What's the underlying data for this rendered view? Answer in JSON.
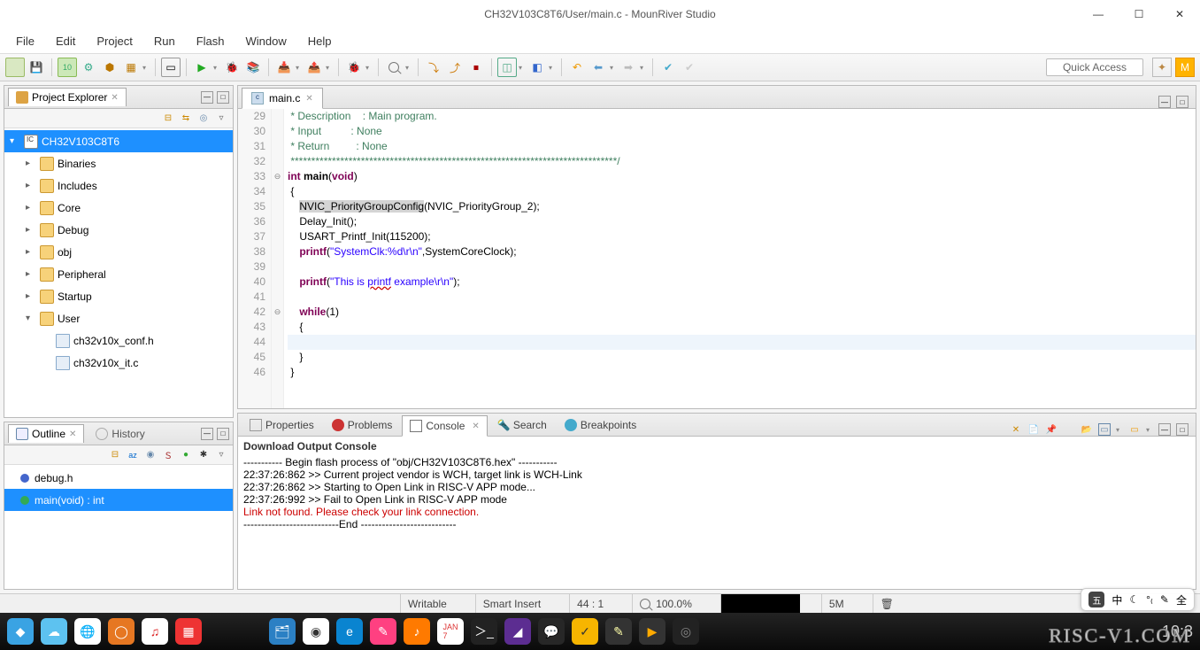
{
  "window": {
    "title": "CH32V103C8T6/User/main.c - MounRiver Studio"
  },
  "menu": [
    "File",
    "Edit",
    "Project",
    "Run",
    "Flash",
    "Window",
    "Help"
  ],
  "quick_access": "Quick Access",
  "explorer": {
    "title": "Project Explorer",
    "project": "CH32V103C8T6",
    "nodes": [
      {
        "label": "Binaries",
        "icon": "binaries",
        "indent": 1
      },
      {
        "label": "Includes",
        "icon": "includes",
        "indent": 1
      },
      {
        "label": "Core",
        "icon": "folder",
        "indent": 1
      },
      {
        "label": "Debug",
        "icon": "folder",
        "indent": 1
      },
      {
        "label": "obj",
        "icon": "folder",
        "indent": 1
      },
      {
        "label": "Peripheral",
        "icon": "folder",
        "indent": 1
      },
      {
        "label": "Startup",
        "icon": "folder",
        "indent": 1
      },
      {
        "label": "User",
        "icon": "folder",
        "indent": 1,
        "open": true
      },
      {
        "label": "ch32v10x_conf.h",
        "icon": "file",
        "indent": 2
      },
      {
        "label": "ch32v10x_it.c",
        "icon": "file",
        "indent": 2
      }
    ]
  },
  "editor": {
    "tab": "main.c",
    "lines": [
      {
        "n": 29,
        "cmt": " * Description    : Main program."
      },
      {
        "n": 30,
        "cmt": " * Input          : None"
      },
      {
        "n": 31,
        "cmt": " * Return         : None"
      },
      {
        "n": 32,
        "cmt": " *******************************************************************************/"
      },
      {
        "n": 33,
        "fold": "⊖",
        "raw": "<span class='kw'>int</span> <span class='fn' style='font-weight:bold'>main</span>(<span class='kw'>void</span>)"
      },
      {
        "n": 34,
        "raw": " {"
      },
      {
        "n": 35,
        "raw": "    <span class='fnh'>NVIC_PriorityGroupConfig</span>(NVIC_PriorityGroup_2);"
      },
      {
        "n": 36,
        "raw": "    Delay_Init();"
      },
      {
        "n": 37,
        "raw": "    USART_Printf_Init(115200);"
      },
      {
        "n": 38,
        "raw": "    <span class='kw'>printf</span>(<span class='str'>\"SystemClk:%d\\r\\n\"</span>,SystemCoreClock);"
      },
      {
        "n": 39,
        "raw": ""
      },
      {
        "n": 40,
        "raw": "    <span class='kw'>printf</span>(<span class='str'>\"This is <span class='underline'>printf</span> example\\r\\n\"</span>);"
      },
      {
        "n": 41,
        "raw": ""
      },
      {
        "n": 42,
        "fold": "⊖",
        "raw": "    <span class='kw'>while</span>(1)"
      },
      {
        "n": 43,
        "raw": "    {"
      },
      {
        "n": 44,
        "raw": "",
        "hl": true
      },
      {
        "n": 45,
        "raw": "    }"
      },
      {
        "n": 46,
        "raw": " }"
      }
    ]
  },
  "views": {
    "tabs": [
      "Properties",
      "Problems",
      "Console",
      "Search",
      "Breakpoints"
    ],
    "active": 2,
    "console_title": "Download Output Console",
    "console_lines": [
      {
        "t": "----------- Begin flash process of \"obj/CH32V103C8T6.hex\" -----------"
      },
      {
        "t": "22:37:26:862 >> Current project vendor is WCH, target link is WCH-Link"
      },
      {
        "t": ""
      },
      {
        "t": "22:37:26:862 >> Starting to Open Link in RISC-V APP mode..."
      },
      {
        "t": "22:37:26:992 >> Fail to Open Link in RISC-V APP mode"
      },
      {
        "t": ""
      },
      {
        "t": "Link not found. Please check your link connection.",
        "err": true
      },
      {
        "t": "---------------------------End ---------------------------"
      }
    ]
  },
  "outline": {
    "tab1": "Outline",
    "tab2": "History",
    "items": [
      {
        "label": "debug.h",
        "color": "#4466cc"
      },
      {
        "label": "main(void) : int",
        "color": "#33aa55",
        "selected": true
      }
    ]
  },
  "status": {
    "writable": "Writable",
    "insert": "Smart Insert",
    "pos": "44 : 1",
    "zoom": "100.0%"
  },
  "tray_items": [
    "中",
    "☾",
    "°₍",
    "✎",
    "全"
  ],
  "watermark": "RISC-V1.COM",
  "task_time": "10:3"
}
